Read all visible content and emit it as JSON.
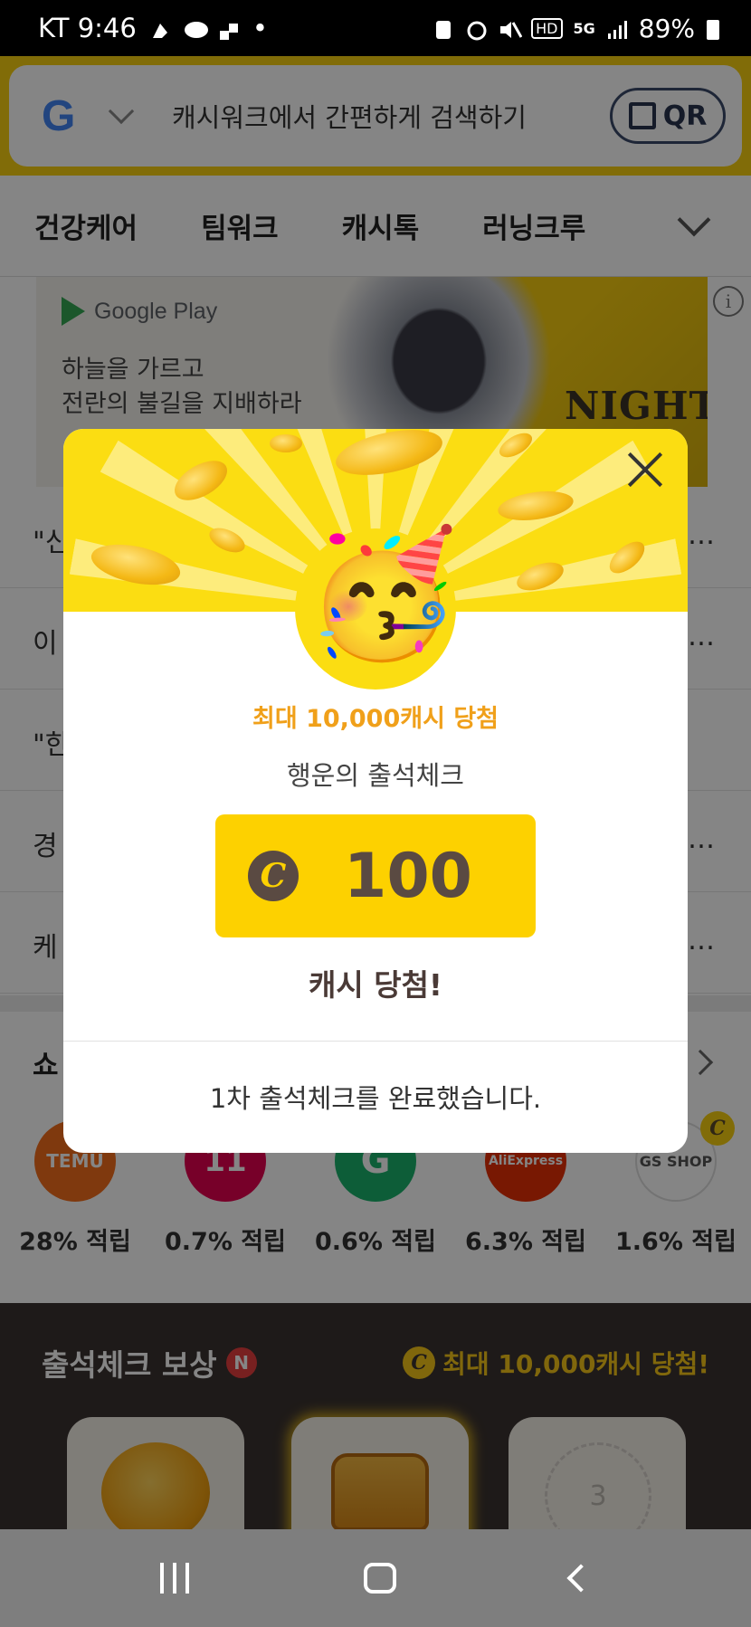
{
  "status_bar": {
    "carrier_time": "KT 9:46",
    "dot": "•",
    "hd": "HD",
    "network": "5G",
    "battery": "89%"
  },
  "search": {
    "engine_icon": "google-icon",
    "google_letter": "G",
    "placeholder": "캐시워크에서 간편하게 검색하기",
    "qr_label": "QR"
  },
  "tabs": [
    "건강케어",
    "팀워크",
    "캐시톡",
    "러닝크루"
  ],
  "ad": {
    "store": "Google Play",
    "line1": "하늘을 가르고",
    "line2": "전란의 불길을 지배하라",
    "title_partial": "NIGHT",
    "info": "i"
  },
  "news": [
    {
      "left": "\"신",
      "right": "…"
    },
    {
      "left": "이",
      "right": "…"
    },
    {
      "left": "\"한",
      "right": ""
    },
    {
      "left": "경",
      "right": "…"
    },
    {
      "left": "케",
      "right": "…"
    }
  ],
  "shopping": {
    "title_partial": "쇼",
    "stores": [
      {
        "name": "TEMU",
        "rate": "28% 적립",
        "color": "#f46d1c"
      },
      {
        "name": "11",
        "rate": "0.7% 적립",
        "color": "#e5004f"
      },
      {
        "name": "G",
        "rate": "0.6% 적립",
        "color": "#19b36b"
      },
      {
        "name": "AliExpress",
        "rate": "6.3% 적립",
        "color": "#e62e04"
      },
      {
        "name": "GS SHOP",
        "rate": "1.6% 적립",
        "color": "#ffffff"
      }
    ],
    "badge": "C"
  },
  "attendance": {
    "title": "출석체크 보상",
    "new_badge": "N",
    "right_text": "최대 10,000캐시 당첨!",
    "coin_symbol": "C",
    "card3_number": "3"
  },
  "modal": {
    "emoji": "🥳",
    "subtitle": "최대 10,000캐시 당첨",
    "title": "행운의 출석체크",
    "coin_symbol": "C",
    "amount": "100",
    "win_text": "캐시 당첨!",
    "footer": "1차 출석체크를 완료했습니다."
  },
  "colors": {
    "accent_yellow": "#fbdd12",
    "cash_yellow": "#fdd100",
    "orange_text": "#f0a01a",
    "dark_brown": "#5a4a42"
  }
}
